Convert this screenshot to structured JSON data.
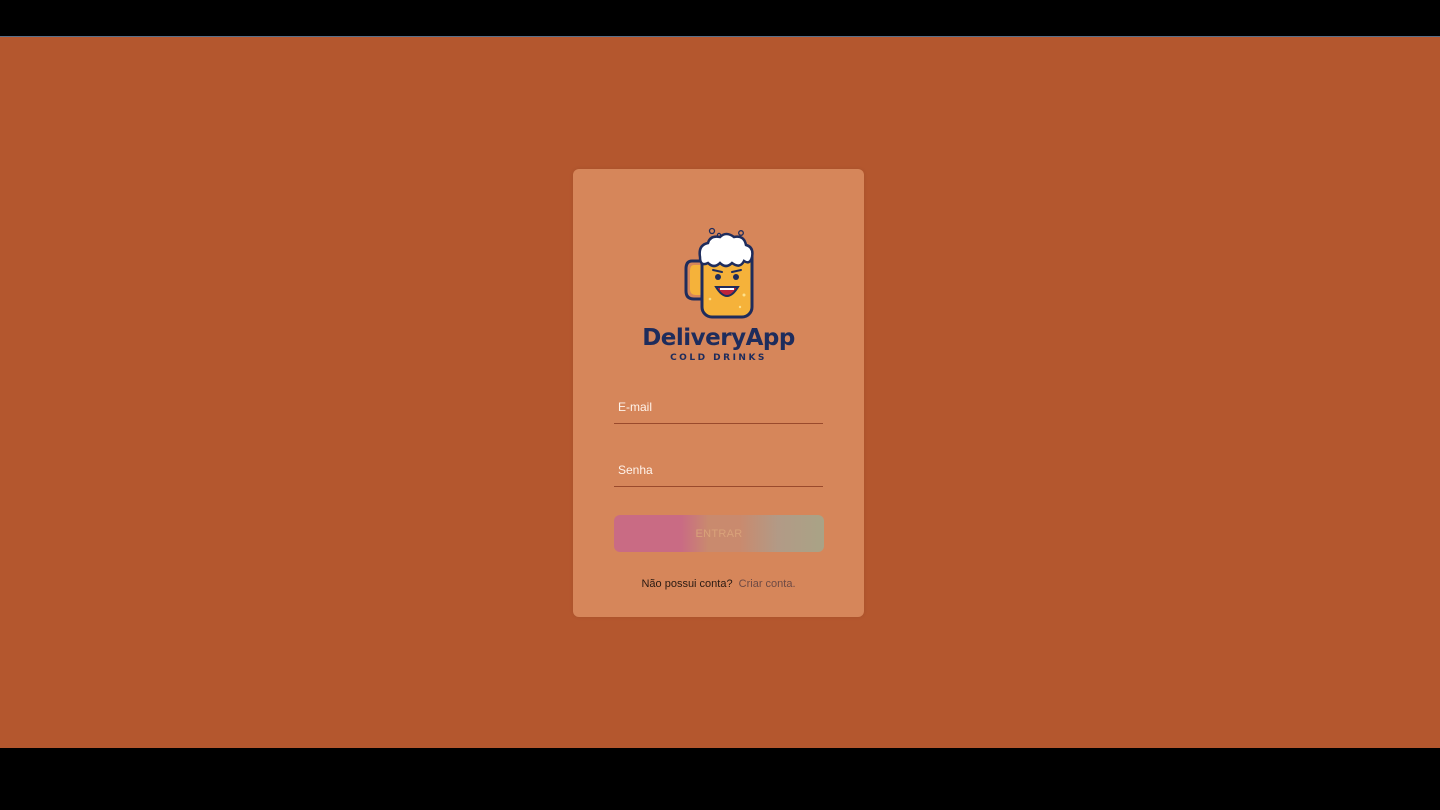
{
  "brand": {
    "name": "DeliveryApp",
    "tagline": "COLD DRINKS",
    "logo_icon": "beer-mug-mascot-icon"
  },
  "login": {
    "email_placeholder": "E-mail",
    "password_placeholder": "Senha",
    "submit_label": "ENTRAR",
    "no_account_text": "Não possui conta?",
    "signup_link_label": "Criar conta."
  },
  "colors": {
    "background": "#b4572e",
    "card": "#d6865a",
    "brand_text": "#1e2c5c",
    "button_gradient_start": "#c96b84",
    "button_gradient_end": "#a9a386"
  }
}
